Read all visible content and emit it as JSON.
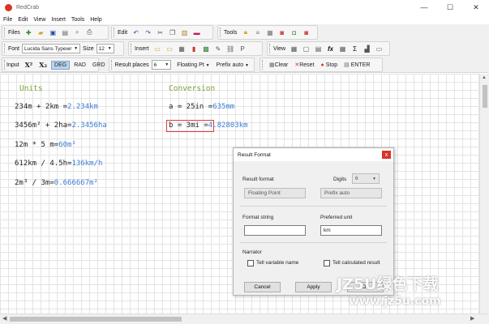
{
  "window": {
    "title": "RedCrab",
    "controls": [
      "—",
      "☐",
      "✕"
    ]
  },
  "menu": [
    "File",
    "Edit",
    "View",
    "Insert",
    "Tools",
    "Help"
  ],
  "toolbar": {
    "files_label": "Files",
    "edit_label": "Edit",
    "tools_label": "Tools",
    "font_label": "Font",
    "font_value": "Lucida Sans Typewr",
    "size_label": "Size",
    "size_value": "12",
    "insert_label": "Insert",
    "view_label": "View",
    "input_label": "Input",
    "x_super": "X²",
    "x_sub": "X₂",
    "deg": "DEG",
    "rad": "RAD",
    "grd": "GRD",
    "result_places_label": "Result places",
    "result_places_value": "6",
    "floating_pt": "Floating Pt",
    "prefix_auto": "Prefix auto",
    "clear": "Clear",
    "reset": "Reset",
    "stop": "Stop",
    "enter": "ENTER"
  },
  "document": {
    "units_header": "Units",
    "conversion_header": "Conversion",
    "units_lines": [
      {
        "expr": "234m + 2km =",
        "result": "2.234km"
      },
      {
        "expr": "3456m² + 2ha=",
        "result": "2.3456ha"
      },
      {
        "expr": "12m * 5 m=",
        "result": "60m²"
      },
      {
        "expr": "612km / 4.5h=",
        "result": "136km/h"
      },
      {
        "expr": "2m³ / 3m=",
        "result": "0.666667m²"
      }
    ],
    "conversion_lines": [
      {
        "expr": "a = 25in =",
        "result": "635mm"
      },
      {
        "expr": "b = 3mi =",
        "result": "4.82803km"
      }
    ]
  },
  "dialog": {
    "title": "Result Format",
    "close": "x",
    "result_format_label": "Result format",
    "digits_label": "Digits",
    "digits_value": "6",
    "floating_point": "Floating Point",
    "prefix_auto": "Prefix auto",
    "format_string_label": "Format string",
    "format_string_value": "",
    "preferred_unit_label": "Preferred unit",
    "preferred_unit_value": "km",
    "narrator_label": "Narrator",
    "tell_variable_name": "Tell variable name",
    "tell_calculated_result": "Tell calculated result",
    "cancel": "Cancel",
    "apply": "Apply",
    "ok": "Ok"
  },
  "watermark": {
    "line1": "JZ5U绿色下载",
    "line2": "www.jz5u.com"
  }
}
